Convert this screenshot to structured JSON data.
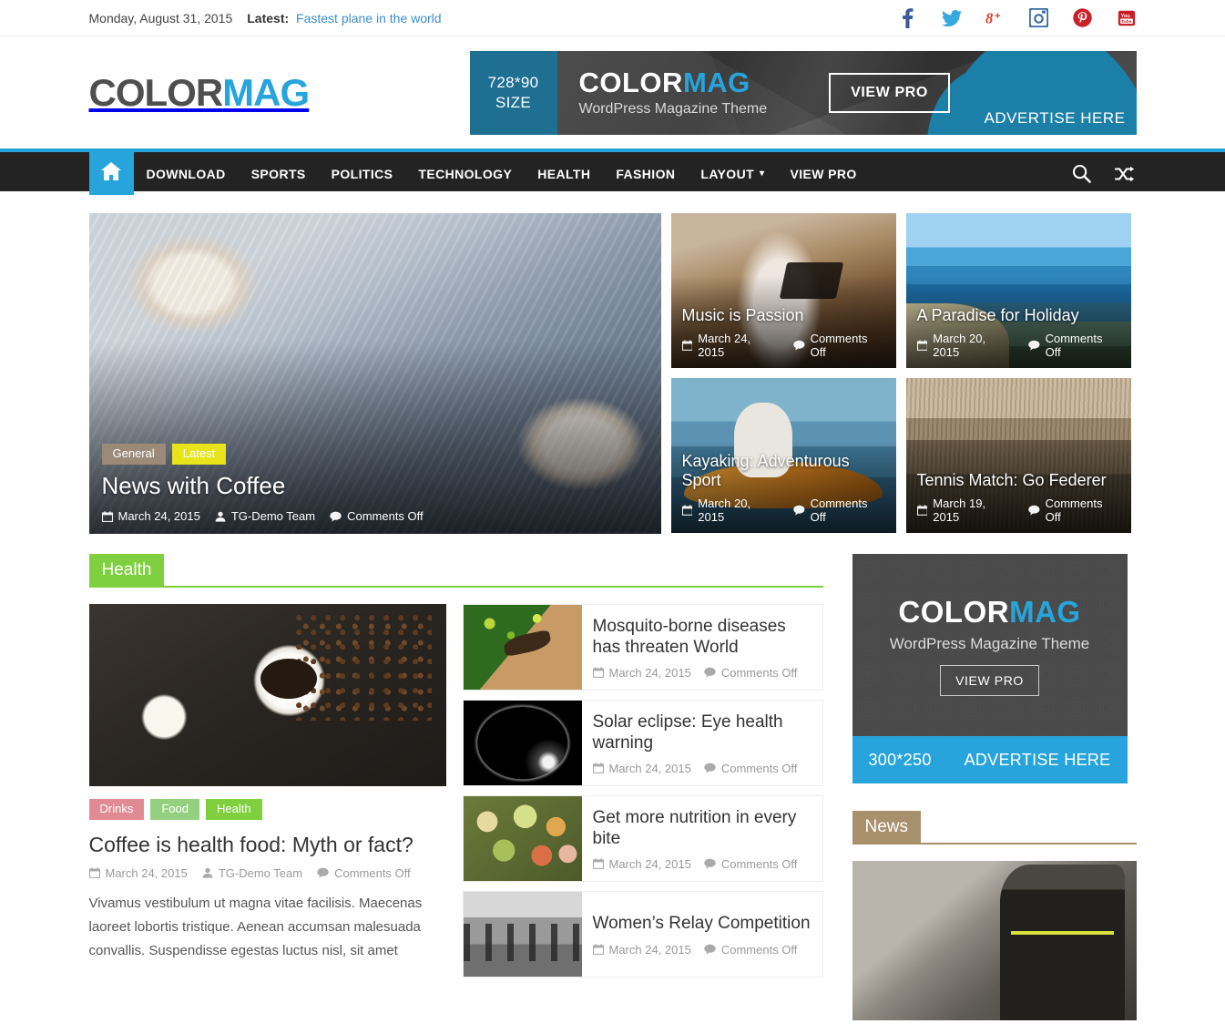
{
  "topbar": {
    "date": "Monday, August 31, 2015",
    "latest_label": "Latest:",
    "latest_link": "Fastest plane in the world",
    "social": [
      {
        "name": "facebook-icon"
      },
      {
        "name": "twitter-icon"
      },
      {
        "name": "googleplus-icon"
      },
      {
        "name": "instagram-icon"
      },
      {
        "name": "pinterest-icon"
      },
      {
        "name": "youtube-icon"
      }
    ]
  },
  "header": {
    "logo_part1": "COLOR",
    "logo_part2": "MAG",
    "banner": {
      "size_line1": "728*90",
      "size_line2": "SIZE",
      "title_part1": "COLOR",
      "title_part2": "MAG",
      "subtitle": "WordPress Magazine Theme",
      "button": "VIEW PRO",
      "advertise": "ADVERTISE HERE"
    }
  },
  "nav": {
    "home_icon": "home-icon",
    "items": [
      {
        "label": "DOWNLOAD",
        "has_caret": false
      },
      {
        "label": "SPORTS",
        "has_caret": false
      },
      {
        "label": "POLITICS",
        "has_caret": false
      },
      {
        "label": "TECHNOLOGY",
        "has_caret": false
      },
      {
        "label": "HEALTH",
        "has_caret": false
      },
      {
        "label": "FASHION",
        "has_caret": false
      },
      {
        "label": "LAYOUT",
        "has_caret": true
      },
      {
        "label": "VIEW PRO",
        "has_caret": false
      }
    ],
    "search_icon": "search-icon",
    "random_icon": "random-post-icon"
  },
  "featured": {
    "main": {
      "title": "News with Coffee",
      "badges": [
        {
          "label": "General",
          "color": "#9c8a78"
        },
        {
          "label": "Latest",
          "color": "#e8e41c"
        }
      ],
      "date": "March 24, 2015",
      "author": "TG-Demo Team",
      "comments": "Comments Off"
    },
    "side": [
      {
        "title": "Music is Passion",
        "date": "March 24, 2015",
        "comments": "Comments Off",
        "image": "piano-room"
      },
      {
        "title": "A Paradise for Holiday",
        "date": "March 20, 2015",
        "comments": "Comments Off",
        "image": "beach-cove"
      },
      {
        "title": "Kayaking: Adventurous Sport",
        "date": "March 20, 2015",
        "comments": "Comments Off",
        "image": "kayaker"
      },
      {
        "title": "Tennis Match: Go Federer",
        "date": "March 19, 2015",
        "comments": "Comments Off",
        "image": "tennis-stadium"
      }
    ]
  },
  "health_section": {
    "heading": "Health",
    "accent_color": "#7ed03f",
    "feature": {
      "image": "coffee-cup-and-beans",
      "badges": [
        {
          "label": "Drinks",
          "color": "#e08b94"
        },
        {
          "label": "Food",
          "color": "#93d180"
        },
        {
          "label": "Health",
          "color": "#7ed03f"
        }
      ],
      "title": "Coffee is health food: Myth or fact?",
      "date": "March 24, 2015",
      "author": "TG-Demo Team",
      "comments": "Comments Off",
      "excerpt": "Vivamus vestibulum ut magna vitae facilisis. Maecenas laoreet lobortis tristique. Aenean accumsan malesuada convallis. Suspendisse egestas luctus nisl, sit amet"
    },
    "list": [
      {
        "title": "Mosquito-borne diseases has threaten World",
        "date": "March 24, 2015",
        "comments": "Comments Off",
        "image": "mosquito"
      },
      {
        "title": "Solar eclipse: Eye health warning",
        "date": "March 24, 2015",
        "comments": "Comments Off",
        "image": "solar-eclipse"
      },
      {
        "title": "Get more nutrition in every bite",
        "date": "March 24, 2015",
        "comments": "Comments Off",
        "image": "assorted-fruit"
      },
      {
        "title": "Women’s Relay Competition",
        "date": "March 24, 2015",
        "comments": "Comments Off",
        "image": "relay-runners"
      }
    ]
  },
  "sidebar": {
    "ad": {
      "title_part1": "COLOR",
      "title_part2": "MAG",
      "subtitle": "WordPress Magazine Theme",
      "button": "VIEW PRO",
      "size": "300*250",
      "advertise": "ADVERTISE HERE"
    },
    "news_widget": {
      "heading": "News",
      "accent_color": "#a8906d",
      "image": "firefighter-pointing"
    }
  }
}
